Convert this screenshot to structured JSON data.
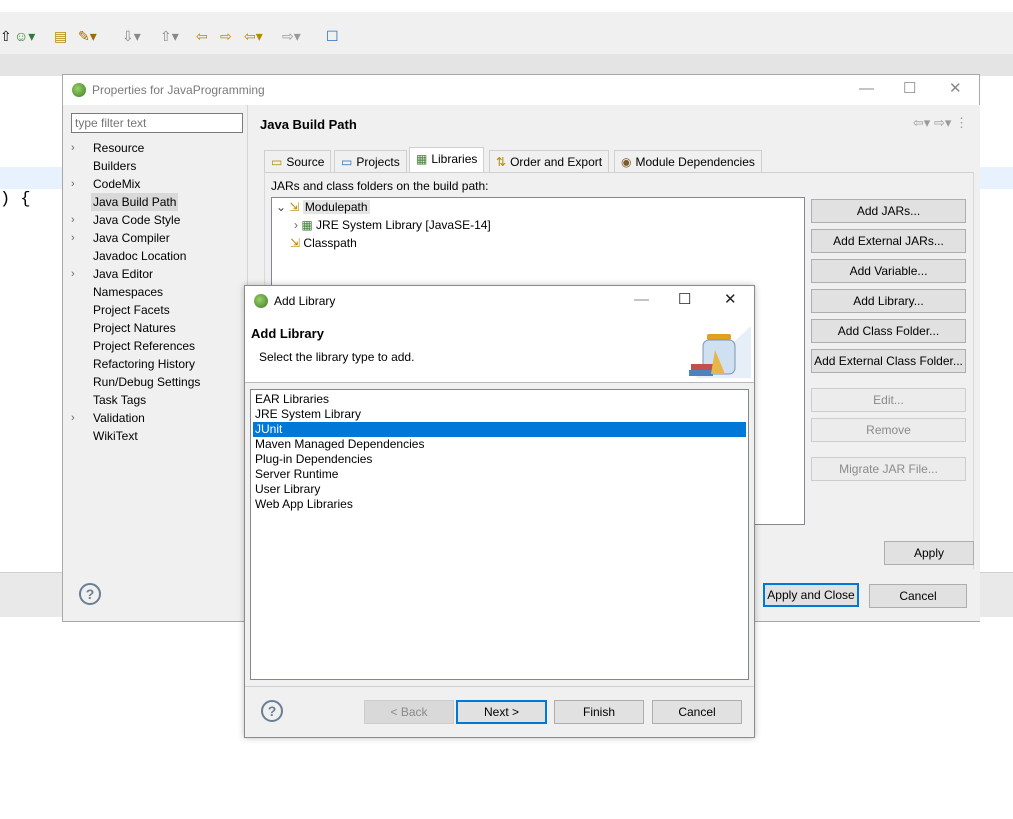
{
  "background": {
    "editor_code": ") {"
  },
  "props": {
    "title": "Properties for JavaProgramming",
    "filter_placeholder": "type filter text",
    "tree": [
      {
        "label": "Resource",
        "expandable": true
      },
      {
        "label": "Builders",
        "expandable": false
      },
      {
        "label": "CodeMix",
        "expandable": true
      },
      {
        "label": "Java Build Path",
        "expandable": false,
        "selected": true
      },
      {
        "label": "Java Code Style",
        "expandable": true
      },
      {
        "label": "Java Compiler",
        "expandable": true
      },
      {
        "label": "Javadoc Location",
        "expandable": false
      },
      {
        "label": "Java Editor",
        "expandable": true
      },
      {
        "label": "Namespaces",
        "expandable": false
      },
      {
        "label": "Project Facets",
        "expandable": false
      },
      {
        "label": "Project Natures",
        "expandable": false
      },
      {
        "label": "Project References",
        "expandable": false
      },
      {
        "label": "Refactoring History",
        "expandable": false
      },
      {
        "label": "Run/Debug Settings",
        "expandable": false
      },
      {
        "label": "Task Tags",
        "expandable": false
      },
      {
        "label": "Validation",
        "expandable": true
      },
      {
        "label": "WikiText",
        "expandable": false
      }
    ],
    "heading": "Java Build Path",
    "tabs": [
      "Source",
      "Projects",
      "Libraries",
      "Order and Export",
      "Module Dependencies"
    ],
    "active_tab": "Libraries",
    "jars_label": "JARs and class folders on the build path:",
    "jars_tree": {
      "modulepath": "Modulepath",
      "jre": "JRE System Library [JavaSE-14]",
      "classpath": "Classpath"
    },
    "buttons": {
      "add_jars": "Add JARs...",
      "add_external_jars": "Add External JARs...",
      "add_variable": "Add Variable...",
      "add_library": "Add Library...",
      "add_class_folder": "Add Class Folder...",
      "add_external_class_folder": "Add External Class Folder...",
      "edit": "Edit...",
      "remove": "Remove",
      "migrate": "Migrate JAR File...",
      "apply": "Apply",
      "apply_close": "Apply and Close",
      "cancel": "Cancel"
    }
  },
  "addlib": {
    "title": "Add Library",
    "heading": "Add Library",
    "subheading": "Select the library type to add.",
    "items": [
      "EAR Libraries",
      "JRE System Library",
      "JUnit",
      "Maven Managed Dependencies",
      "Plug-in Dependencies",
      "Server Runtime",
      "User Library",
      "Web App Libraries"
    ],
    "selected": "JUnit",
    "buttons": {
      "back": "< Back",
      "next": "Next >",
      "finish": "Finish",
      "cancel": "Cancel"
    }
  },
  "colors": {
    "selection": "#0078d7",
    "dialog_bg": "#f0f0f0"
  }
}
